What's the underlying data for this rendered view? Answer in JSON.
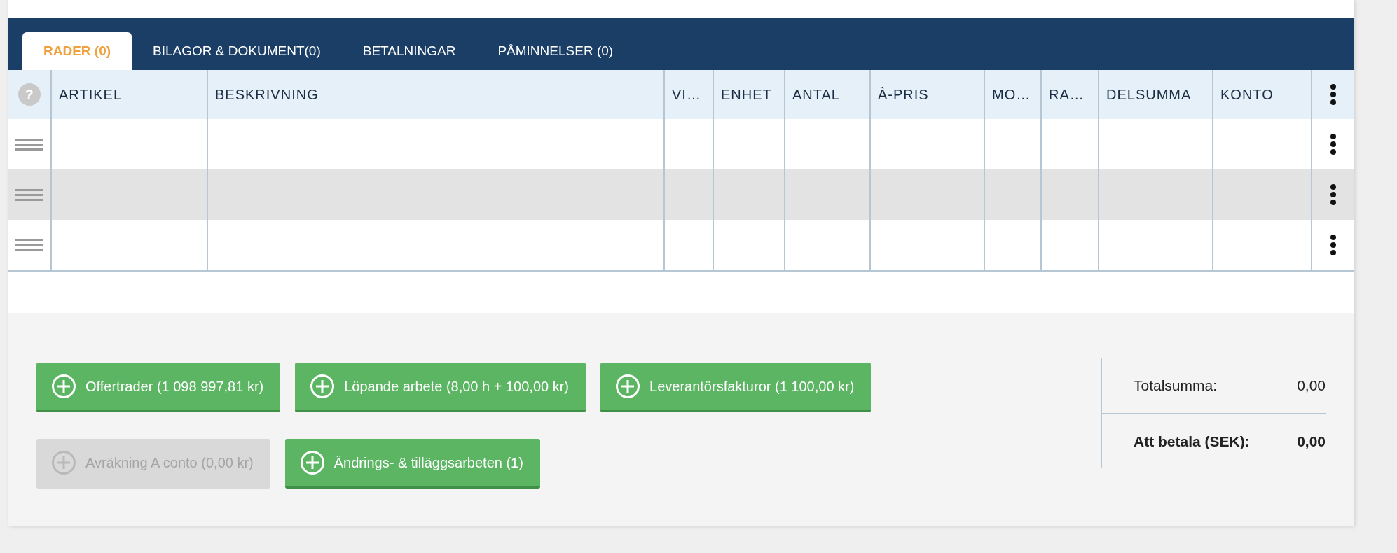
{
  "tabs": [
    {
      "label": "RADER (0)",
      "selected": true
    },
    {
      "label": "BILAGOR & DOKUMENT(0)",
      "selected": false
    },
    {
      "label": "BETALNINGAR",
      "selected": false
    },
    {
      "label": "PÅMINNELSER (0)",
      "selected": false
    }
  ],
  "table": {
    "help_mark": "?",
    "columns": [
      "ARTIKEL",
      "BESKRIVNING",
      "VI…",
      "ENHET",
      "ANTAL",
      "À-PRIS",
      "MO…",
      "RA…",
      "DELSUMMA",
      "KONTO"
    ],
    "rows": [
      {
        "shaded": false
      },
      {
        "shaded": true
      },
      {
        "shaded": false
      }
    ]
  },
  "buttons": [
    {
      "label": "Offertrader (1 098 997,81 kr)",
      "disabled": false
    },
    {
      "label": "Löpande arbete (8,00 h + 100,00 kr)",
      "disabled": false
    },
    {
      "label": "Leverantörsfakturor (1 100,00 kr)",
      "disabled": false
    },
    {
      "label": "Avräkning A conto (0,00 kr)",
      "disabled": true
    },
    {
      "label": "Ändrings- & tilläggsarbeten (1)",
      "disabled": false
    }
  ],
  "totals": [
    {
      "kind": "total",
      "label": "Totalsumma:",
      "value": "0,00"
    },
    {
      "kind": "due",
      "label": "Att betala (SEK):",
      "value": "0,00"
    }
  ]
}
